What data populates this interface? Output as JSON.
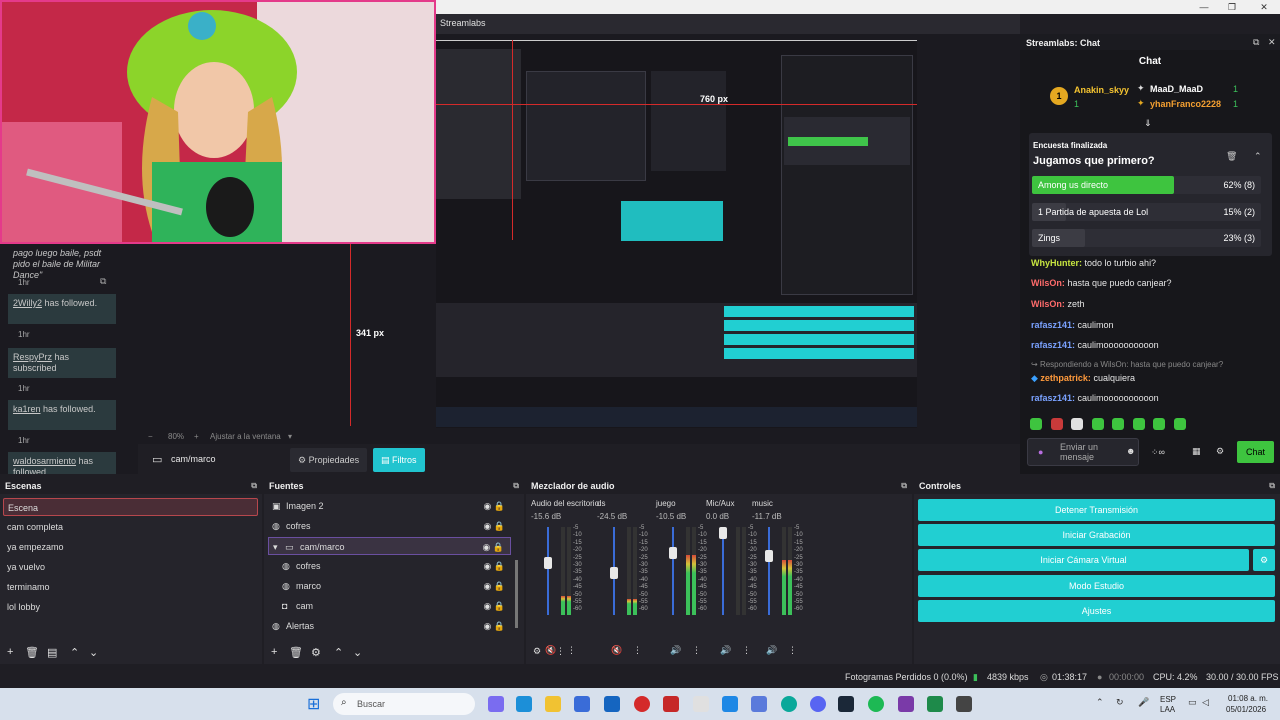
{
  "window": {
    "title": "Streamlabs",
    "controls": [
      "—",
      "❐",
      "✕"
    ]
  },
  "activity_feed": {
    "items": [
      {
        "text": "pago luego baile, psdt pido el baile de Militar Dance\"",
        "time": "1hr"
      },
      {
        "user": "2Willy2",
        "action": "has followed.",
        "time": "1hr"
      },
      {
        "user": "RespyPrz",
        "action": "has subscribed",
        "time": "1hr"
      },
      {
        "user": "ka1ren",
        "action": "has followed.",
        "time": "1hr"
      },
      {
        "user": "waldosarmiento",
        "action": "has followed."
      }
    ]
  },
  "preview": {
    "zoom": "80%",
    "fit_label": "Ajustar a la ventana",
    "measure_top": "760 px",
    "measure_left": "341 px"
  },
  "path_row": {
    "path": "cam/marco",
    "properties_label": "Propiedades",
    "filters_label": "Filtros"
  },
  "scenes": {
    "title": "Escenas",
    "items": [
      "Escena",
      "cam completa",
      "ya empezamo",
      "ya vuelvo",
      "terminamo",
      "lol lobby"
    ]
  },
  "sources": {
    "title": "Fuentes",
    "items": [
      {
        "label": "Imagen 2",
        "icon": "image-icon",
        "indent": 0
      },
      {
        "label": "cofres",
        "icon": "globe-icon",
        "indent": 0
      },
      {
        "label": "cam/marco",
        "icon": "folder-icon",
        "indent": 0
      },
      {
        "label": "cofres",
        "icon": "globe-icon",
        "indent": 1
      },
      {
        "label": "marco",
        "icon": "globe-icon",
        "indent": 1
      },
      {
        "label": "cam",
        "icon": "camera-icon",
        "indent": 1
      },
      {
        "label": "Alertas",
        "icon": "globe-icon",
        "indent": 0
      }
    ]
  },
  "mixer": {
    "title": "Mezclador de audio",
    "channels": [
      {
        "name": "Audio del escritorio",
        "db": "-15.6 dB",
        "level": 0.22
      },
      {
        "name": "ds",
        "db": "-24.5 dB",
        "level": 0.18
      },
      {
        "name": "juego",
        "db": "-10.5 dB",
        "level": 0.68
      },
      {
        "name": "Mic/Aux",
        "db": "0.0 dB",
        "level": 0.0
      },
      {
        "name": "music",
        "db": "-11.7 dB",
        "level": 0.62
      }
    ],
    "scale": [
      "-5",
      "-10",
      "-15",
      "-20",
      "-25",
      "-30",
      "-35",
      "-40",
      "-45",
      "-50",
      "-55",
      "-60"
    ]
  },
  "controls": {
    "title": "Controles",
    "buttons": [
      "Detener Transmisión",
      "Iniciar Grabación",
      "Iniciar Cámara Virtual",
      "Modo Estudio",
      "Ajustes"
    ]
  },
  "status": {
    "dropped": "Fotogramas Perdidos 0 (0.0%)",
    "bitrate": "4839 kbps",
    "stream_time": "01:38:17",
    "rec_time": "00:00:00",
    "cpu": "CPU: 4.2%",
    "fps": "30.00 / 30.00 FPS"
  },
  "chat": {
    "window_title": "Streamlabs: Chat",
    "header": "Chat",
    "top_gifters": [
      {
        "name": "Anakin_skyy",
        "rank": "1",
        "count": "1"
      },
      {
        "name": "MaaD_MaaD",
        "count": "1"
      },
      {
        "name": "yhanFranco2228",
        "count": "1"
      }
    ],
    "poll": {
      "status": "Encuesta finalizada",
      "question": "Jugamos que primero?",
      "options": [
        {
          "label": "Among us directo",
          "pct": "62% (8)",
          "value": 0.62,
          "winner": true
        },
        {
          "label": "1 Partida de apuesta de Lol",
          "pct": "15% (2)",
          "value": 0.15,
          "winner": false
        },
        {
          "label": "Zings",
          "pct": "23% (3)",
          "value": 0.23,
          "winner": false
        }
      ]
    },
    "messages": [
      {
        "user": "WhyHunter:",
        "text": "todo lo turbio ahi?",
        "color": "#c8e640"
      },
      {
        "user": "WilsOn:",
        "text": "hasta que puedo canjear?",
        "color": "#ff6b6b"
      },
      {
        "user": "WilsOn:",
        "text": "zeth",
        "color": "#ff6b6b"
      },
      {
        "user": "rafasz141:",
        "text": "caulimon",
        "color": "#7aa2ff"
      },
      {
        "user": "rafasz141:",
        "text": "caulimoooooooooon",
        "color": "#7aa2ff"
      },
      {
        "user": "",
        "text": "Respondiendo a WilsOn: hasta que puedo canjear?",
        "color": "#888888",
        "reply": true
      },
      {
        "user": "zethpatrick:",
        "text": "cualquiera",
        "color": "#ff9a3c"
      },
      {
        "user": "rafasz141:",
        "text": "caulimoooooooooon",
        "color": "#7aa2ff"
      }
    ],
    "input_placeholder": "Enviar un mensaje",
    "send_label": "Chat"
  },
  "taskbar": {
    "search_placeholder": "Buscar",
    "lang": "ESP",
    "region": "LAA",
    "time": "01:08 a. m.",
    "date": "05/01/2026"
  }
}
